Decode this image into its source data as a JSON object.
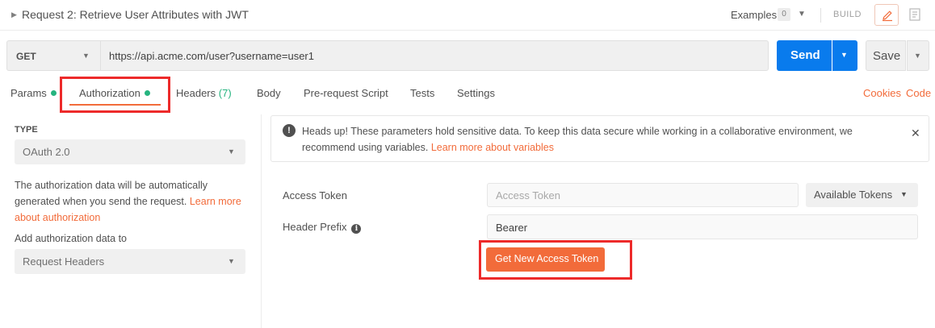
{
  "header": {
    "title": "Request 2: Retrieve User Attributes with JWT",
    "examples_label": "Examples",
    "examples_count": "0",
    "build_label": "BUILD"
  },
  "request": {
    "method": "GET",
    "url": "https://api.acme.com/user?username=user1",
    "send_label": "Send",
    "save_label": "Save"
  },
  "tabs": [
    {
      "label": "Params",
      "has_dot": true
    },
    {
      "label": "Authorization",
      "has_dot": true,
      "active": true
    },
    {
      "label": "Headers",
      "count": "(7)"
    },
    {
      "label": "Body"
    },
    {
      "label": "Pre-request Script"
    },
    {
      "label": "Tests"
    },
    {
      "label": "Settings"
    }
  ],
  "links": {
    "cookies": "Cookies",
    "code": "Code"
  },
  "auth_panel": {
    "type_label": "TYPE",
    "type_value": "OAuth 2.0",
    "description": "The authorization data will be automatically generated when you send the request.",
    "learn_more": "Learn more about authorization",
    "add_to_label": "Add authorization data to",
    "add_to_value": "Request Headers"
  },
  "alert": {
    "text": "Heads up! These parameters hold sensitive data. To keep this data secure while working in a collaborative environment, we recommend using variables.",
    "link": "Learn more about variables"
  },
  "oauth": {
    "access_token_label": "Access Token",
    "access_token_placeholder": "Access Token",
    "available_tokens_label": "Available Tokens",
    "header_prefix_label": "Header Prefix",
    "header_prefix_value": "Bearer",
    "get_token_label": "Get New Access Token"
  },
  "colors": {
    "accent": "#f26b3a",
    "primary": "#097bed",
    "status_green": "#26b47f",
    "highlight_red": "#ed2a2a"
  }
}
